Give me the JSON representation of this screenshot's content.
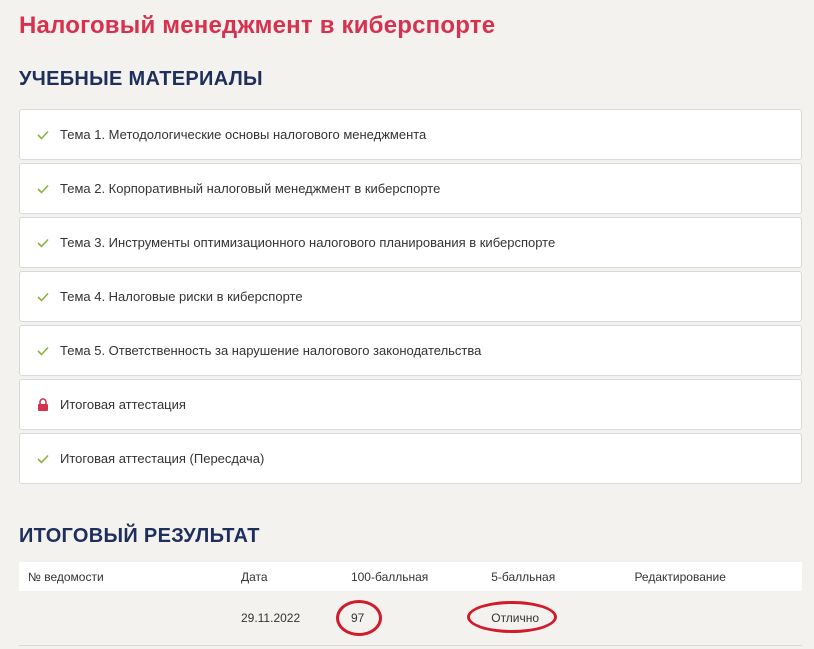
{
  "course": {
    "title": "Налоговый менеджмент в киберспорте"
  },
  "materials": {
    "heading": "УЧЕБНЫЕ МАТЕРИАЛЫ",
    "items": [
      {
        "label": "Тема 1. Методологические основы налогового менеджмента",
        "icon": "check-icon",
        "status": "completed"
      },
      {
        "label": "Тема 2. Корпоративный налоговый менеджмент в киберспорте",
        "icon": "check-icon",
        "status": "completed"
      },
      {
        "label": "Тема 3. Инструменты оптимизационного налогового планирования в киберспорте",
        "icon": "check-icon",
        "status": "completed"
      },
      {
        "label": "Тема 4. Налоговые риски в киберспорте",
        "icon": "check-icon",
        "status": "completed"
      },
      {
        "label": "Тема 5. Ответственность за нарушение налогового законодательства",
        "icon": "check-icon",
        "status": "completed"
      },
      {
        "label": "Итоговая аттестация",
        "icon": "lock-icon",
        "status": "locked"
      },
      {
        "label": "Итоговая аттестация (Пересдача)",
        "icon": "check-icon",
        "status": "completed"
      }
    ]
  },
  "results": {
    "heading": "ИТОГОВЫЙ РЕЗУЛЬТАТ",
    "columns": [
      "№ ведомости",
      "Дата",
      "100-балльная",
      "5-балльная",
      "Редактирование"
    ],
    "rows": [
      {
        "statement_no": "",
        "date": "29.11.2022",
        "score_100": "97",
        "score_5": "Отлично",
        "edit": ""
      }
    ]
  },
  "colors": {
    "title": "#d6314f",
    "heading": "#1f2f5c",
    "check": "#8ab33e",
    "lock": "#d6314f",
    "annotation": "#d11a2a"
  }
}
